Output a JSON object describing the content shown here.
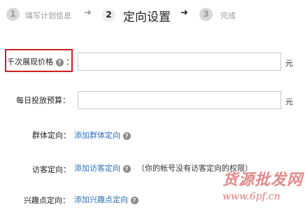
{
  "steps": [
    {
      "num": "1",
      "label": "填写计划信息"
    },
    {
      "num": "2",
      "label": "定向设置"
    },
    {
      "num": "3",
      "label": "完成"
    }
  ],
  "arrow_glyph": "➜",
  "form": {
    "cpm_label": "千次展现价格",
    "cpm_colon": "：",
    "cpm_unit": "元",
    "budget_label": "每日投放预算：",
    "budget_unit": "元",
    "group_label": "群体定向：",
    "group_link": "添加群体定向",
    "visitor_label": "访客定向：",
    "visitor_link": "添加访客定向",
    "visitor_note": "（你的帐号没有访客定向的权限）",
    "interest_label": "兴趣点定向：",
    "interest_link": "添加兴趣点定向"
  },
  "help_glyph": "?",
  "watermark": {
    "text": "货源批发网",
    "url": "www.6pf.cn"
  },
  "colors": {
    "highlight": "#cc1f1f",
    "link": "#2a6fb7"
  }
}
